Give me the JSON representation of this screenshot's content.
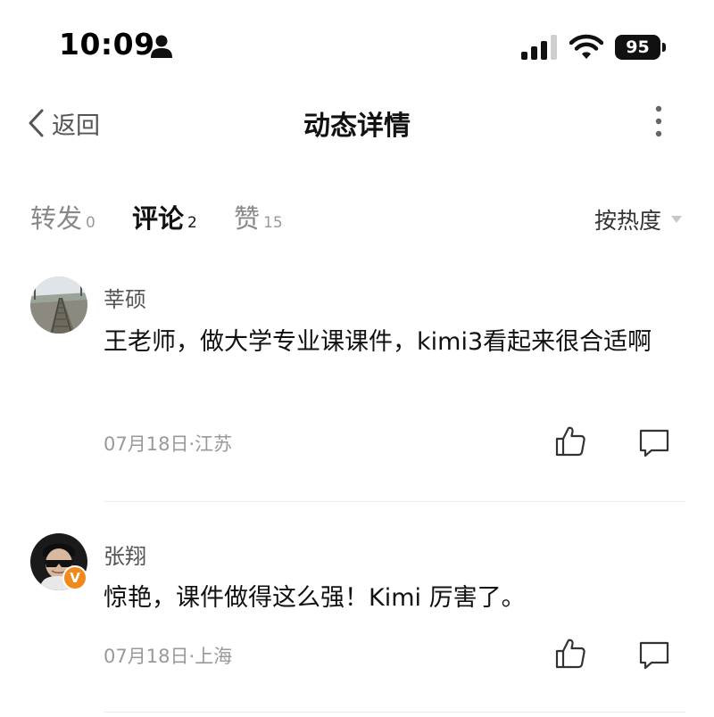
{
  "status_bar": {
    "time": "10:09",
    "battery": "95",
    "icons": [
      "person-icon",
      "signal-icon",
      "wifi-icon",
      "battery-icon"
    ]
  },
  "nav": {
    "back_label": "返回",
    "title": "动态详情",
    "icons": [
      "chevron-left-icon",
      "more-vertical-icon"
    ]
  },
  "tabs": [
    {
      "label": "转发",
      "count": "0",
      "active": false
    },
    {
      "label": "评论",
      "count": "2",
      "active": true
    },
    {
      "label": "赞",
      "count": "15",
      "active": false
    }
  ],
  "sort": {
    "label": "按热度",
    "icon": "caret-down-icon"
  },
  "comments": [
    {
      "author": "莘硕",
      "text": "王老师，做大学专业课课件，kimi3看起来很合适啊",
      "meta": "07月18日·江苏",
      "avatar": "railway-track-photo"
    },
    {
      "author": "张翔",
      "text": "惊艳，课件做得这么强！Kimi 厉害了。",
      "meta": "07月18日·上海",
      "avatar": "person-with-sunglasses-photo",
      "badge": "V"
    }
  ],
  "colors": {
    "accent_badge": "#f08a1d",
    "text_primary": "#111111",
    "text_secondary": "#999999"
  }
}
